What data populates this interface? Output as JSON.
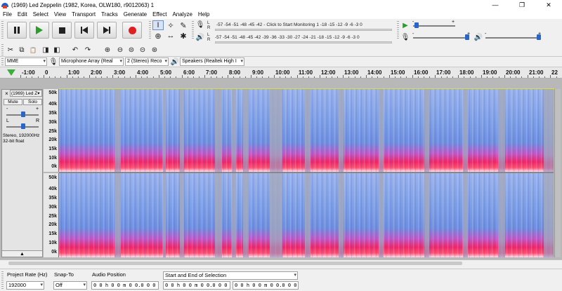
{
  "window": {
    "title": "(1969) Led Zeppelin (1982, Korea, OLW180, r9012063) 1",
    "minimize": "—",
    "maximize": "❐",
    "close": "✕"
  },
  "menu": [
    "File",
    "Edit",
    "Select",
    "View",
    "Transport",
    "Tracks",
    "Generate",
    "Effect",
    "Analyze",
    "Help"
  ],
  "transport": {
    "icons": [
      "pause-icon",
      "play-icon",
      "stop-icon",
      "skip-to-start-icon",
      "skip-to-end-icon",
      "record-icon"
    ]
  },
  "tools": {
    "selection": "I",
    "envelope": "✧",
    "draw": "✎",
    "zoom": "⊕",
    "timeshift": "↔",
    "multi": "✱"
  },
  "meters": {
    "record_scale": "-57 -54 -51 -48 -45 -42 -",
    "record_hint": "Click to Start Monitoring",
    "record_scale_tail": "1 -18 -15 -12 -9 -6 -3 0",
    "playback_scale": "-57 -54 -51 -48 -45 -42 -39 -36 -33 -30 -27 -24 -21 -18 -15 -12 -9 -6 -3 0",
    "left_label": "L",
    "right_label": "R",
    "slider_min": "-",
    "slider_max": "+"
  },
  "edit_icons": {
    "cut": "✂",
    "copy": "⧉",
    "paste": "📋",
    "trim": "◨",
    "silence": "◧",
    "undo": "↶",
    "redo": "↷",
    "zoom_in": "⊕",
    "zoom_out": "⊖",
    "fit_selection": "⊜",
    "fit_project": "⊝",
    "zoom_toggle": "⊛"
  },
  "devices": {
    "host": "MME",
    "recording_device": "Microphone Array (Real",
    "channels": "2 (Stereo) Reco",
    "playback_device": "Speakers (Realtek High I"
  },
  "ruler": {
    "labels": [
      "-1:00",
      "0",
      "1:00",
      "2:00",
      "3:00",
      "4:00",
      "5:00",
      "6:00",
      "7:00",
      "8:00",
      "9:00",
      "10:00",
      "11:00",
      "12:00",
      "13:00",
      "14:00",
      "15:00",
      "16:00",
      "17:00",
      "18:00",
      "19:00",
      "20:00",
      "21:00",
      "22"
    ]
  },
  "track": {
    "close": "×",
    "name": "(1969) Led Z▾",
    "mute": "Mute",
    "solo": "Solo",
    "gain_minus": "-",
    "gain_plus": "+",
    "pan_left": "L",
    "pan_right": "R",
    "format_line1": "Stereo, 192000Hz",
    "format_line2": "32-bit float",
    "collapse": "▲",
    "y_labels": [
      "50k",
      "40k",
      "35k",
      "30k",
      "25k",
      "20k",
      "15k",
      "10k",
      "0k"
    ]
  },
  "selection_toolbar": {
    "project_rate_label": "Project Rate (Hz)",
    "project_rate_value": "192000",
    "snap_to_label": "Snap-To",
    "snap_to_value": "Off",
    "audio_position_label": "Audio Position",
    "audio_position_value": "0 0 h 0 0 m 0 0.0 0 0 s",
    "selection_mode": "Start and End of Selection",
    "selection_start": "0 0 h 0 0 m 0 0.0 0 0 s",
    "selection_end": "0 0 h 0 0 m 0 0.0 0 0 s"
  }
}
